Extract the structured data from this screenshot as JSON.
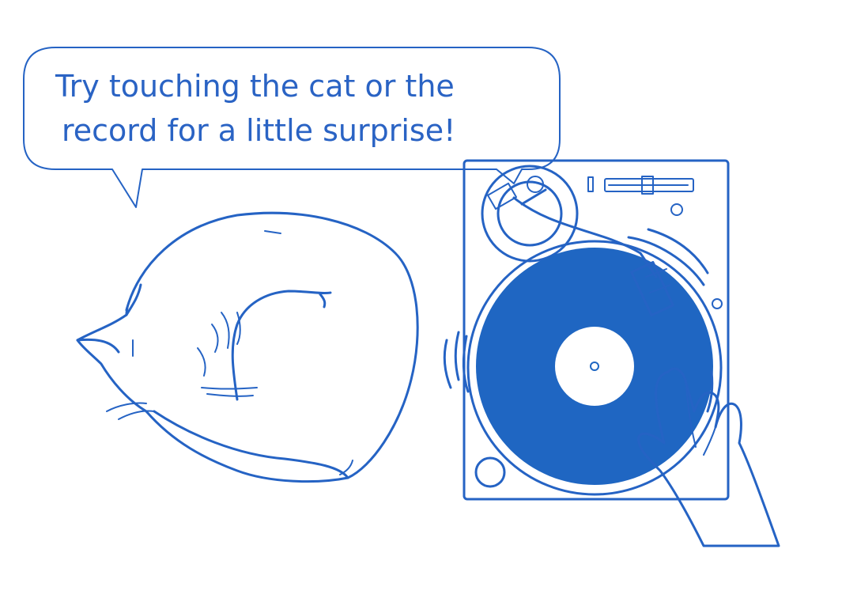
{
  "speech_bubble": {
    "line1": "Try touching the cat or the",
    "line2": "record for a little surprise!"
  },
  "colors": {
    "ink": "#2563c4",
    "record_fill": "#1f66c2",
    "background": "#ffffff"
  },
  "icons": {
    "cat": "sleeping-cat-icon",
    "record": "vinyl-record-icon",
    "turntable": "turntable-icon",
    "hand": "hand-icon"
  }
}
